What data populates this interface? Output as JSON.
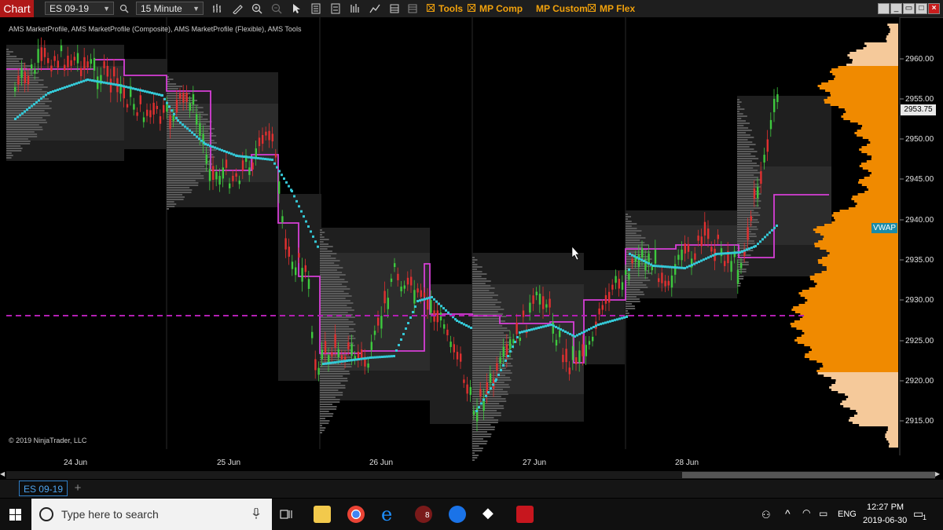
{
  "toolbar": {
    "chart_tab": "Chart",
    "instrument": "ES 09-19",
    "interval": "15 Minute",
    "buttons": [
      {
        "label": "Tools",
        "checked": true
      },
      {
        "label": "MP Comp",
        "checked": true
      },
      {
        "label": "MP Custom",
        "checked": false
      },
      {
        "label": "MP Flex",
        "checked": true
      }
    ]
  },
  "chart": {
    "indicators_label": "AMS MarketProfile, AMS MarketProfile (Composite), AMS MarketProfile (Flexible), AMS Tools",
    "copyright": "© 2019 NinjaTrader, LLC",
    "price_axis": [
      "2960.00",
      "2955.00",
      "2950.00",
      "2945.00",
      "2940.00",
      "2935.00",
      "2930.00",
      "2925.00",
      "2920.00",
      "2915.00"
    ],
    "last_price": "2953.75",
    "vwap_label": "VWAP",
    "dates": [
      "24 Jun",
      "25 Jun",
      "26 Jun",
      "27 Jun",
      "28 Jun"
    ],
    "colors": {
      "vwap": "#35c8d6",
      "poc": "#d63fd6",
      "profile": "#f08a00",
      "up": "#3ec93e",
      "down": "#e03030"
    }
  },
  "bottom": {
    "instrument_tab": "ES 09-19",
    "add_tab": "+"
  },
  "taskbar": {
    "search_placeholder": "Type here to search",
    "language": "ENG",
    "time": "12:27 PM",
    "date": "2019-06-30",
    "notification_count": "1",
    "app_badge": "8"
  }
}
